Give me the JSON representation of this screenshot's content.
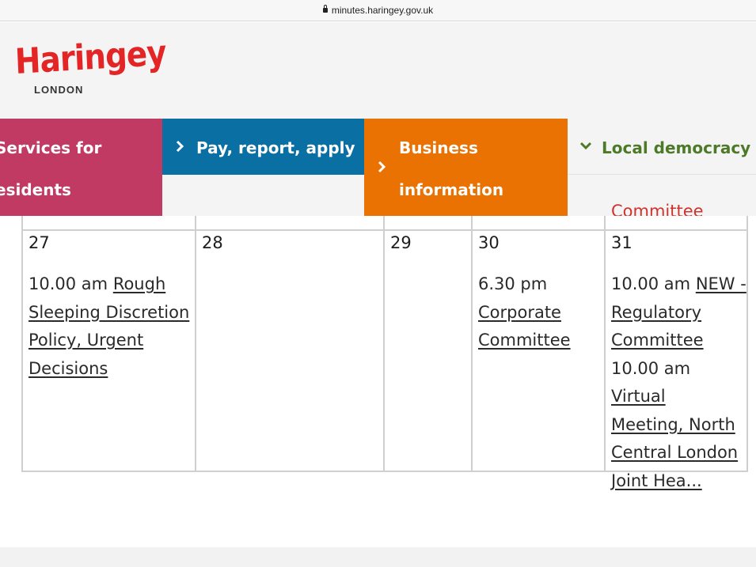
{
  "browser": {
    "url": "minutes.haringey.gov.uk"
  },
  "logo": {
    "wordmark": "Haringey",
    "sub": "LONDON"
  },
  "nav": {
    "services": {
      "line1": "Services for",
      "line2": "esidents",
      "color": "#c03a63"
    },
    "pay": {
      "label": "Pay, report, apply",
      "color": "#0a70a3"
    },
    "business": {
      "line1": "Business",
      "line2": "information",
      "color": "#e97202"
    },
    "local": {
      "label": "Local democracy",
      "color": "#4c7a28"
    }
  },
  "calendar": {
    "partial_above": "Committee",
    "days": [
      {
        "num": "27",
        "events": [
          {
            "time": "10.00 am",
            "title_lines": [
              "Rough",
              "Sleeping Discretion",
              "Policy, Urgent",
              "Decisions"
            ]
          }
        ]
      },
      {
        "num": "28",
        "events": []
      },
      {
        "num": "29",
        "events": []
      },
      {
        "num": "30",
        "events": [
          {
            "time": "6.30 pm",
            "title_lines": [
              "Corporate",
              "Committee"
            ]
          }
        ]
      },
      {
        "num": "31",
        "events": [
          {
            "time": "10.00 am",
            "title_lines": [
              "NEW -",
              "Regulatory",
              "Committee"
            ]
          },
          {
            "time": "10.00 am",
            "title_lines": [
              "Virtual",
              "Meeting, North",
              "Central London",
              "Joint Hea..."
            ]
          }
        ]
      }
    ]
  }
}
